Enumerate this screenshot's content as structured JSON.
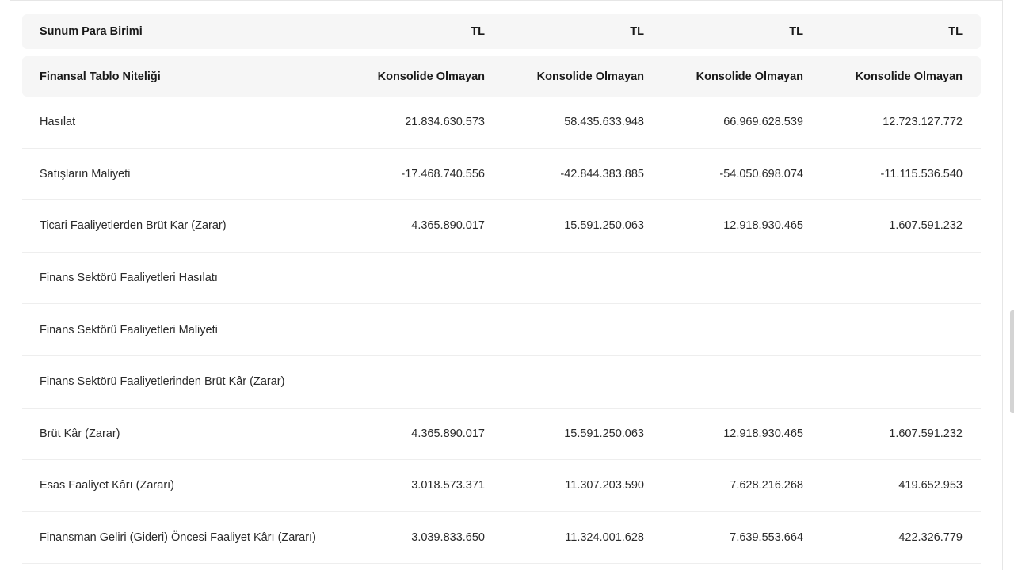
{
  "table": {
    "currency_row": {
      "label": "Sunum Para Birimi",
      "values": [
        "TL",
        "TL",
        "TL",
        "TL"
      ]
    },
    "nature_row": {
      "label": "Finansal Tablo Niteliği",
      "values": [
        "Konsolide Olmayan",
        "Konsolide Olmayan",
        "Konsolide Olmayan",
        "Konsolide Olmayan"
      ]
    },
    "rows": [
      {
        "label": "Hasılat",
        "values": [
          "21.834.630.573",
          "58.435.633.948",
          "66.969.628.539",
          "12.723.127.772"
        ]
      },
      {
        "label": "Satışların Maliyeti",
        "values": [
          "-17.468.740.556",
          "-42.844.383.885",
          "-54.050.698.074",
          "-11.115.536.540"
        ]
      },
      {
        "label": "Ticari Faaliyetlerden Brüt Kar (Zarar)",
        "values": [
          "4.365.890.017",
          "15.591.250.063",
          "12.918.930.465",
          "1.607.591.232"
        ]
      },
      {
        "label": "Finans Sektörü Faaliyetleri Hasılatı",
        "values": [
          "",
          "",
          "",
          ""
        ]
      },
      {
        "label": "Finans Sektörü Faaliyetleri Maliyeti",
        "values": [
          "",
          "",
          "",
          ""
        ]
      },
      {
        "label": "Finans Sektörü Faaliyetlerinden Brüt Kâr (Zarar)",
        "values": [
          "",
          "",
          "",
          ""
        ]
      },
      {
        "label": "Brüt Kâr (Zarar)",
        "values": [
          "4.365.890.017",
          "15.591.250.063",
          "12.918.930.465",
          "1.607.591.232"
        ]
      },
      {
        "label": "Esas Faaliyet Kârı (Zararı)",
        "values": [
          "3.018.573.371",
          "11.307.203.590",
          "7.628.216.268",
          "419.652.953"
        ]
      },
      {
        "label": "Finansman Geliri (Gideri) Öncesi Faaliyet Kârı (Zararı)",
        "values": [
          "3.039.833.650",
          "11.324.001.628",
          "7.639.553.664",
          "422.326.779"
        ]
      }
    ]
  }
}
